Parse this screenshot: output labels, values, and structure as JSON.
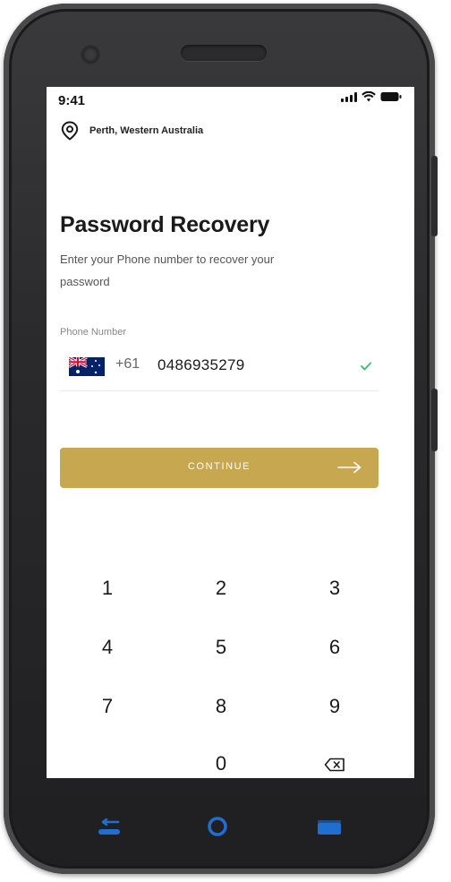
{
  "status_bar": {
    "time": "9:41"
  },
  "location": {
    "text": "Perth, Western Australia"
  },
  "recovery": {
    "title": "Password Recovery",
    "subtitle": "Enter your Phone number to recover your password",
    "phone_label": "Phone Number",
    "dial_code": "+61",
    "phone_value": "0486935279",
    "continue_label": "CONTINUE"
  },
  "keypad": {
    "keys": [
      "1",
      "2",
      "3",
      "4",
      "5",
      "6",
      "7",
      "8",
      "9",
      "0"
    ]
  },
  "colors": {
    "accent": "#c7a74f",
    "check": "#3cba6f",
    "nav_icon": "#1f6fd1"
  },
  "icons": {
    "location": "map-pin-icon",
    "check": "check-icon",
    "arrow": "arrow-right-icon",
    "backspace": "backspace-icon",
    "nav_back": "back-icon",
    "nav_home": "home-icon",
    "nav_recent": "recent-apps-icon"
  }
}
